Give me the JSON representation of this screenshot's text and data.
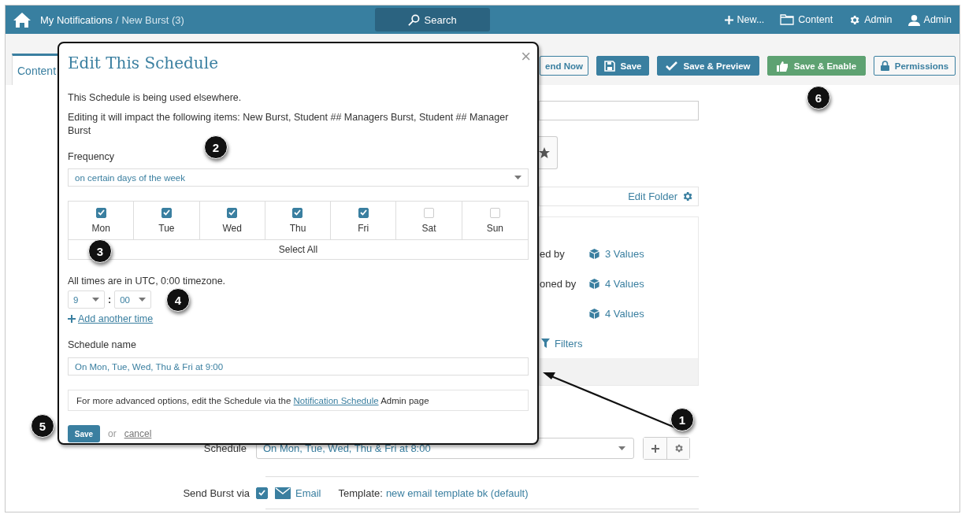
{
  "header": {
    "breadcrumb": [
      {
        "label": "My Notifications",
        "current": false
      },
      {
        "label": "New Burst (3)",
        "current": true
      }
    ],
    "separator": "/",
    "search": "Search",
    "nav": [
      {
        "kind": "new",
        "label": "New..."
      },
      {
        "kind": "folder",
        "label": "Content"
      },
      {
        "kind": "gear",
        "label": "Admin"
      },
      {
        "kind": "user",
        "label": "Admin"
      }
    ]
  },
  "tabs": [
    {
      "label": "Content",
      "selected": true
    }
  ],
  "toolbar": [
    {
      "kind": "outline",
      "label": "end Now"
    },
    {
      "kind": "primary",
      "label": "Save"
    },
    {
      "kind": "primary",
      "label": "Save & Preview"
    },
    {
      "kind": "success",
      "label": "Save & Enable"
    },
    {
      "kind": "outline",
      "label": "Permissions"
    }
  ],
  "page": {
    "folder_link": "Edit Folder",
    "rows": [
      {
        "label": "ed by",
        "value": "3 Values"
      },
      {
        "label": "oned by",
        "value": "4 Values"
      },
      {
        "label": "",
        "value": "4 Values"
      }
    ],
    "filters": "Filters",
    "schedule": {
      "label": "Schedule",
      "value": "On Mon, Tue, Wed, Thu & Fri at 8:00"
    },
    "send": {
      "label": "Send Burst via",
      "checked": true,
      "channel": "Email",
      "template_label": "Template:",
      "template": "new email template bk (default)"
    }
  },
  "dialog": {
    "title": "Edit This Schedule",
    "close": "×",
    "notice": "This Schedule is being used elsewhere.",
    "impact": "Editing it will impact the following items: New Burst, Student ## Managers Burst, Student ## Manager Burst",
    "frequency_label": "Frequency",
    "frequency": "on certain days of the week",
    "days": [
      {
        "label": "Mon",
        "checked": true
      },
      {
        "label": "Tue",
        "checked": true
      },
      {
        "label": "Wed",
        "checked": true
      },
      {
        "label": "Thu",
        "checked": true
      },
      {
        "label": "Fri",
        "checked": true
      },
      {
        "label": "Sat",
        "checked": false
      },
      {
        "label": "Sun",
        "checked": false
      }
    ],
    "select_all": "Select All",
    "timezone_note": "All times are in UTC, 0:00 timezone.",
    "hour": "9",
    "time_separator": ":",
    "minute": "00",
    "add_time": "Add another time",
    "name_label": "Schedule name",
    "name_value": "On Mon, Tue, Wed, Thu & Fri at 9:00",
    "note_before": "For more advanced options, edit the Schedule via the",
    "note_link": "Notification Schedule",
    "note_after": "Admin page",
    "save": "Save",
    "or": "or",
    "cancel": "cancel"
  },
  "callouts": [
    "1",
    "2",
    "3",
    "4",
    "5",
    "6"
  ]
}
